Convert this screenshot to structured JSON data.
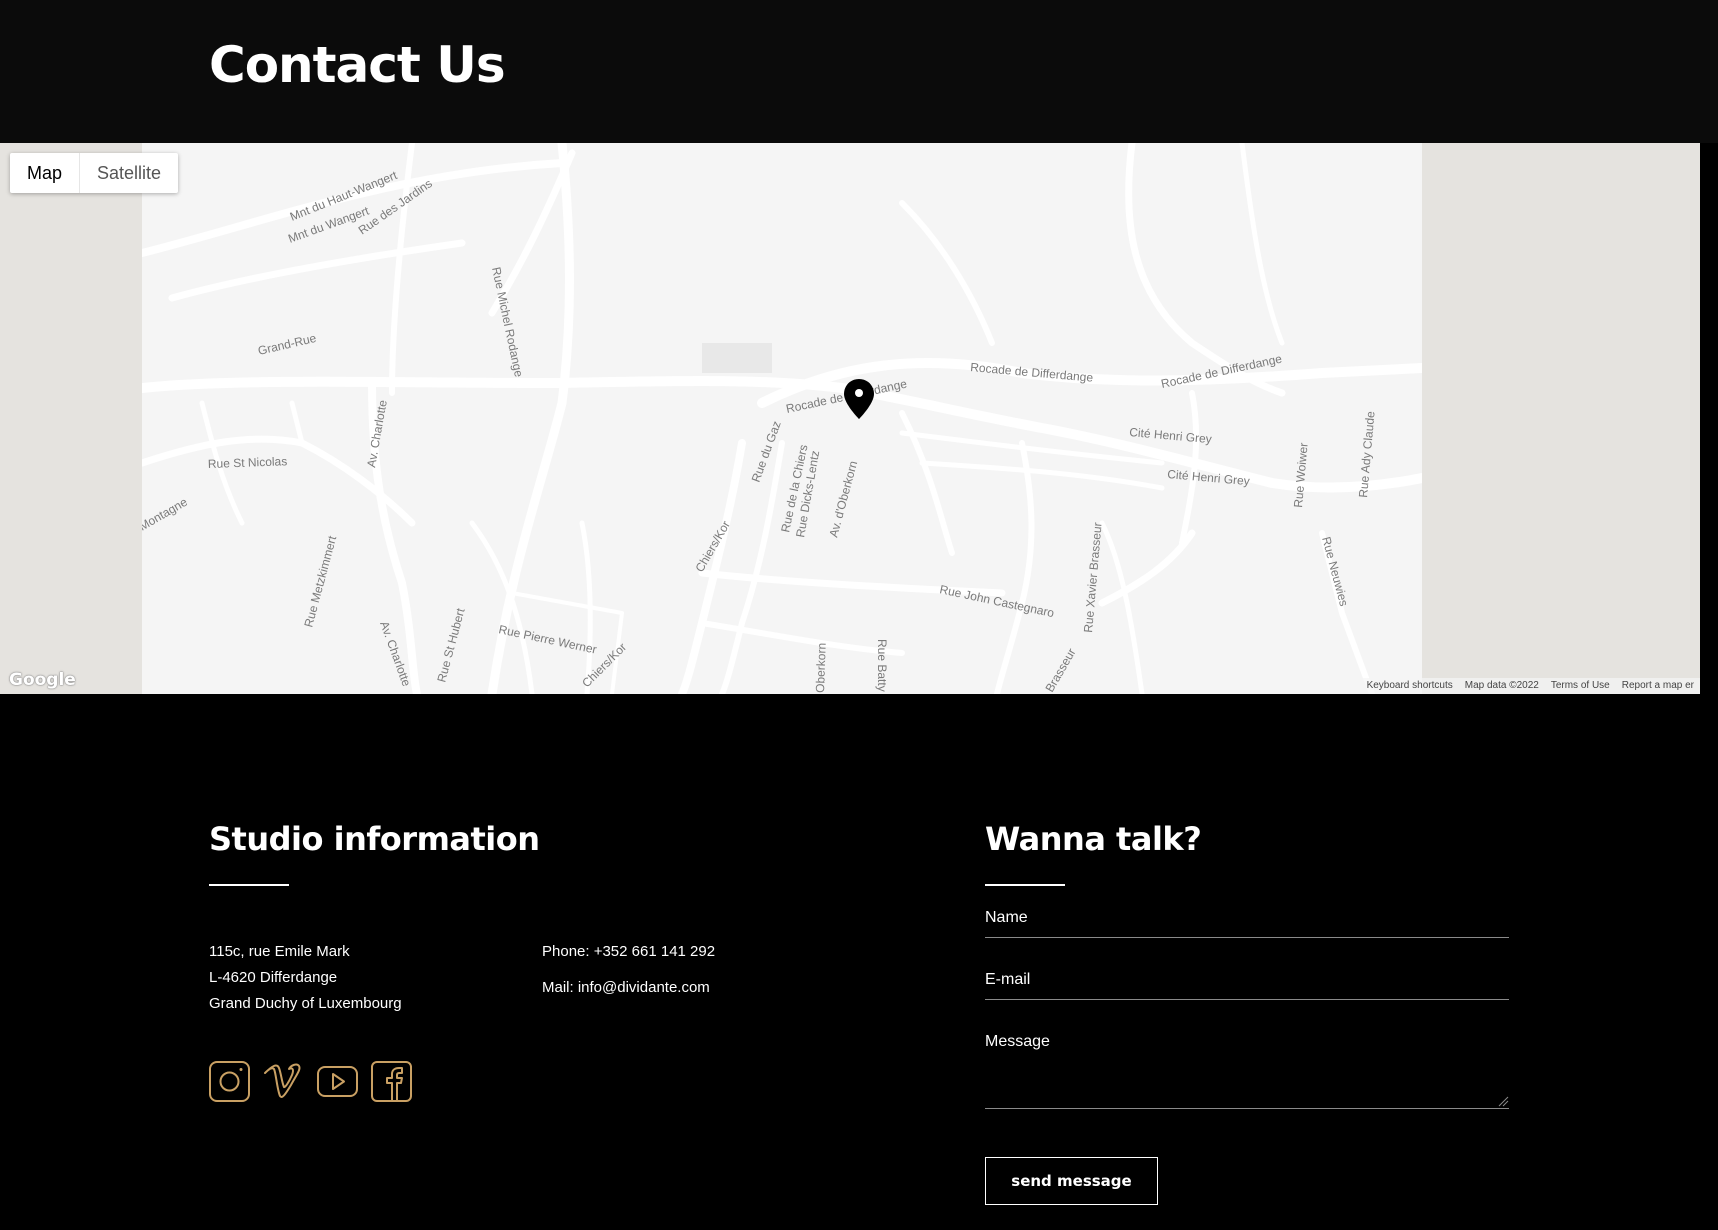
{
  "header": {
    "title": "Contact Us"
  },
  "map": {
    "type_buttons": [
      "Map",
      "Satellite"
    ],
    "logo": "Google",
    "footer_links": [
      "Keyboard shortcuts",
      "Map data ©2022",
      "Terms of Use",
      "Report a map er"
    ],
    "streets": [
      "Mnt du Haut-Wangert",
      "Mnt du Wangert",
      "Rue des Jardins",
      "Rue Michel Rodange",
      "Grand-Rue",
      "Rocade de Differdange",
      "Rocade de Differdange",
      "Rocade de Differdange",
      "Cité Henri Grey",
      "Cité Henri Grey",
      "Rue St Nicolas",
      "Av. Charlotte",
      "Av. Charlotte",
      "Rue Metzkimmert",
      "Rue St Hubert",
      "Rue Pierre Werner",
      "Chiers/Kor",
      "Chiers/Kor",
      "Rue du Gaz",
      "Rue de la Chiers",
      "Rue Dicks-Lentz",
      "Av. d'Oberkorn",
      "Rue John Castegnaro",
      "Rue Xavier Brasseur",
      "Rue Woiwer",
      "Rue Ady Claude",
      "Rue Neuwies",
      "Montagne",
      "Oberkorn",
      "Rue Batty W",
      "Brasseur"
    ]
  },
  "studio": {
    "title": "Studio information",
    "address": [
      "115c, rue Emile Mark",
      "L-4620 Differdange",
      "Grand Duchy of Luxembourg"
    ],
    "phone": "Phone: +352 661 141 292",
    "mail": "Mail: info@dividante.com",
    "social_icons": [
      "instagram-icon",
      "vimeo-icon",
      "youtube-icon",
      "facebook-icon"
    ],
    "accent_color": "#c9a063"
  },
  "contact_form": {
    "title": "Wanna talk?",
    "name_label": "Name",
    "email_label": "E-mail",
    "message_label": "Message",
    "submit_label": "send message"
  }
}
